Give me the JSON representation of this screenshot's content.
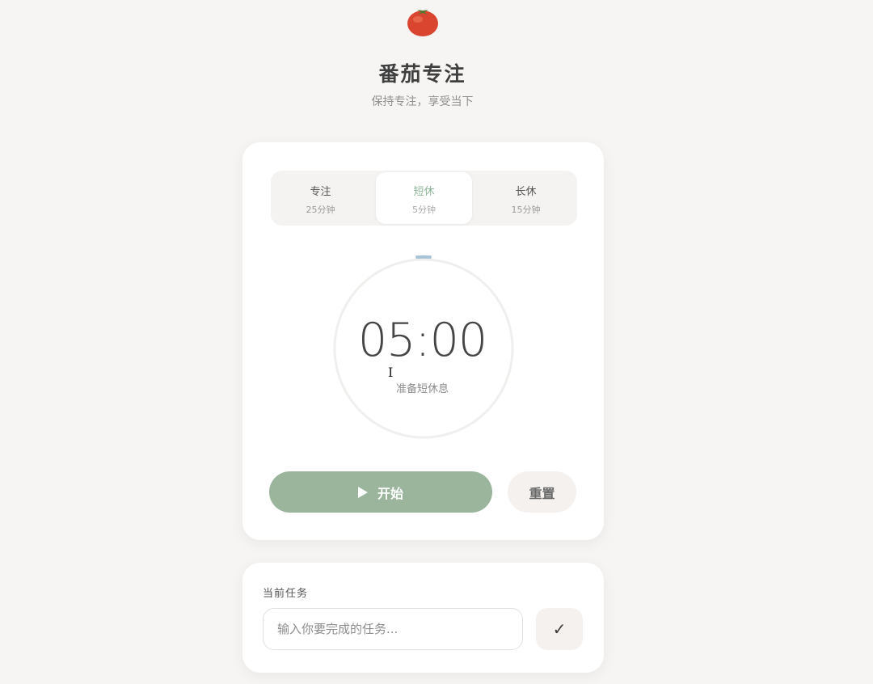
{
  "app": {
    "title": "番茄专注",
    "subtitle": "保持专注，享受当下",
    "logo_icon": "tomato-icon"
  },
  "modes": [
    {
      "label": "专注",
      "duration": "25分钟",
      "active": false
    },
    {
      "label": "短休",
      "duration": "5分钟",
      "active": true
    },
    {
      "label": "长休",
      "duration": "15分钟",
      "active": false
    }
  ],
  "timer": {
    "time": "05:00",
    "status": "准备短休息",
    "progress": 0
  },
  "controls": {
    "start_label": "开始",
    "start_icon": "play-icon",
    "reset_label": "重置"
  },
  "task": {
    "label": "当前任务",
    "placeholder": "输入你要完成的任务...",
    "confirm_label": "✓"
  },
  "colors": {
    "accent": "#9bb59d",
    "active_tab_text": "#8fb59a",
    "progress_dot": "#a8c4d6",
    "background": "#f7f5f3"
  }
}
